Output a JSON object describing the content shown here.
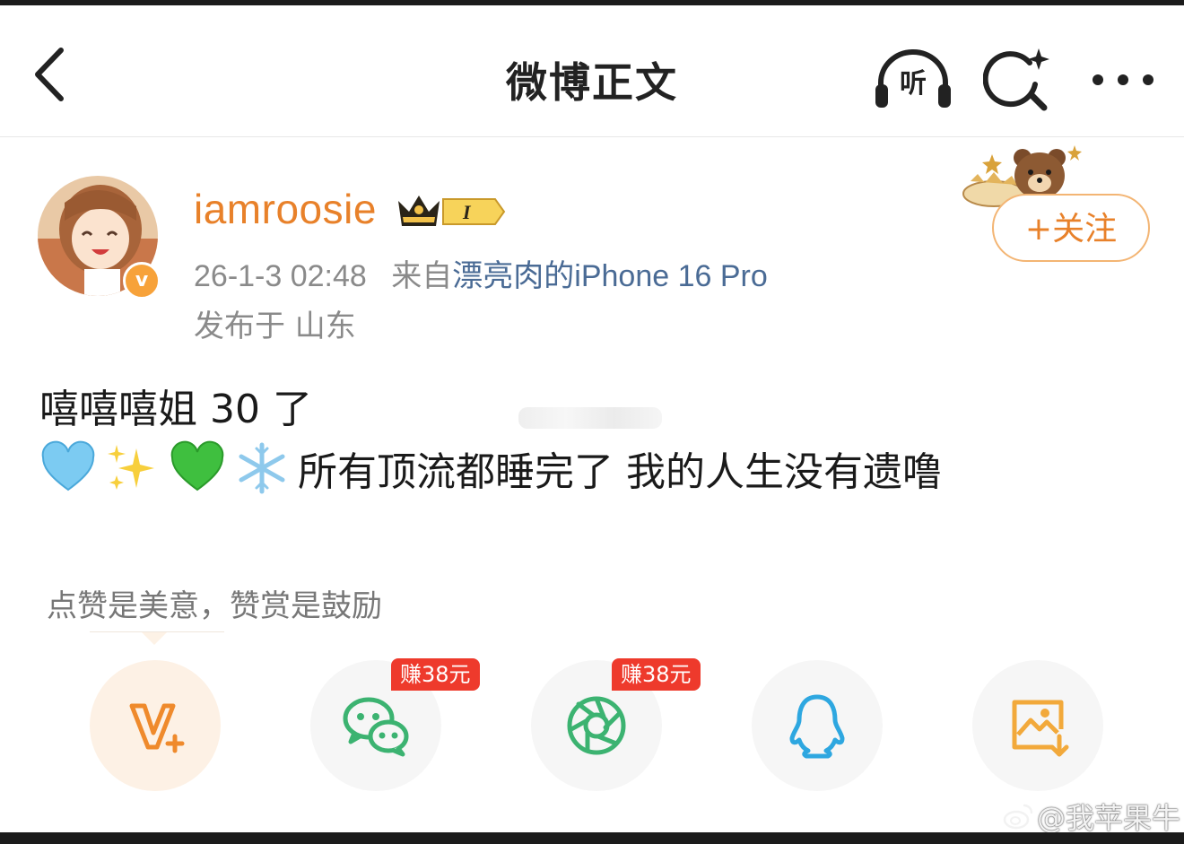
{
  "header": {
    "title": "微博正文",
    "listen_label": "听"
  },
  "post": {
    "username": "iamroosie",
    "vip_level": "I",
    "verified_mark": "v",
    "datetime": "26-1-3 02:48",
    "source_prefix": "来自",
    "source_device": "漂亮肉的iPhone 16 Pro",
    "location": "发布于 山东",
    "follow_label": "+关注",
    "text_line1": "嘻嘻嘻姐 30 了",
    "text_line2": "所有顶流都睡完了 我的人生没有遗噜",
    "emojis": [
      "light-blue-heart",
      "sparkles",
      "green-heart",
      "snowflake"
    ]
  },
  "reward": {
    "hint": "点赞是美意，赞赏是鼓励",
    "wechat_tag": "赚38元",
    "moments_tag": "赚38元",
    "share_targets": [
      "vplus",
      "wechat",
      "wechat-moments",
      "qq",
      "save-image"
    ]
  },
  "watermark": {
    "text": "@我苹果牛"
  },
  "colors": {
    "accent_orange": "#e8812a",
    "device_link": "#4a6b95",
    "earn_red": "#ee3a2c",
    "wechat_green": "#3cb371",
    "qq_blue": "#2ea7e0"
  }
}
